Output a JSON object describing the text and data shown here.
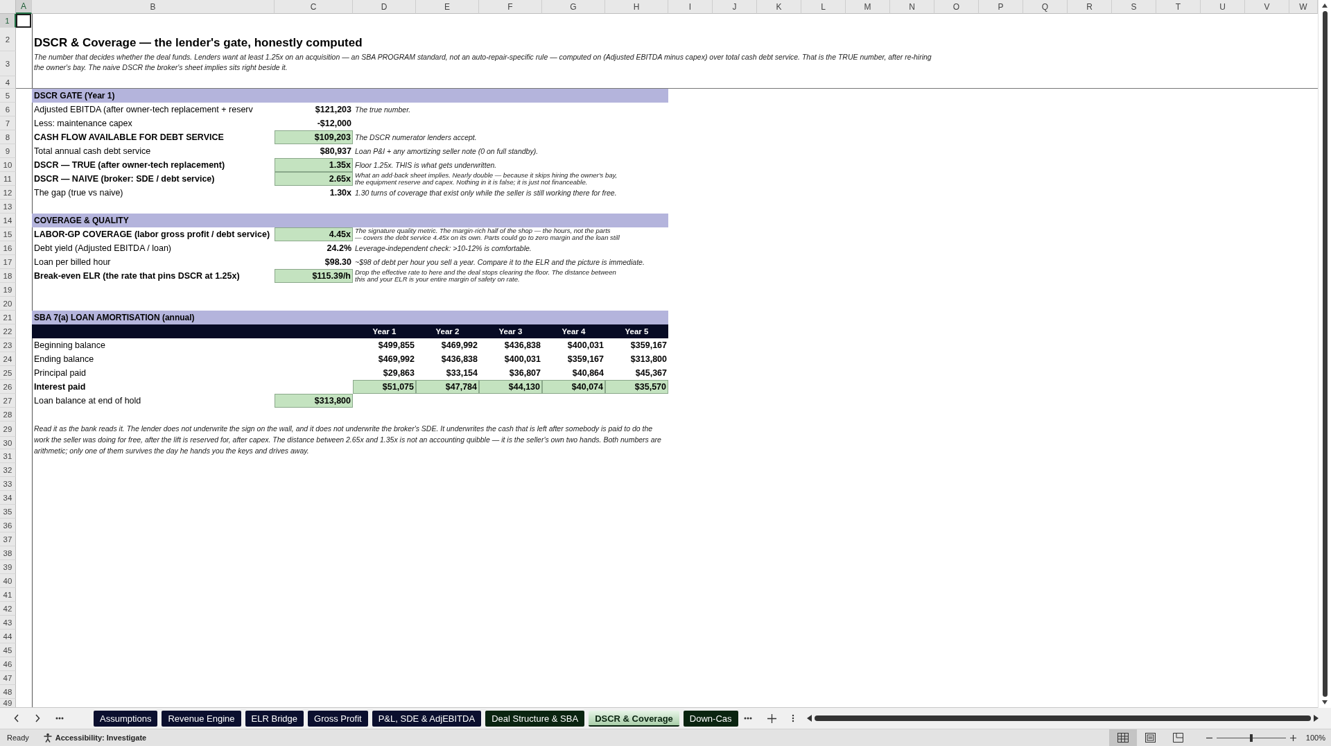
{
  "column_headers": [
    "A",
    "B",
    "C",
    "D",
    "E",
    "F",
    "G",
    "H",
    "I",
    "J",
    "K",
    "L",
    "M",
    "N",
    "O",
    "P",
    "Q",
    "R",
    "S",
    "T",
    "U",
    "V",
    "W"
  ],
  "row_numbers": [
    "1",
    "2",
    "3",
    "4",
    "5",
    "6",
    "7",
    "8",
    "9",
    "10",
    "11",
    "12",
    "13",
    "14",
    "15",
    "16",
    "17",
    "18",
    "19",
    "20",
    "21",
    "22",
    "23",
    "24",
    "25",
    "26",
    "27",
    "28",
    "29",
    "30",
    "31",
    "32",
    "33",
    "34",
    "35",
    "36",
    "37",
    "38",
    "39",
    "40",
    "41",
    "42",
    "43",
    "44",
    "45",
    "46",
    "47",
    "48",
    "49"
  ],
  "title": "DSCR & Coverage — the lender's gate, honestly computed",
  "intro": "The number that decides whether the deal funds. Lenders want at least 1.25x on an acquisition — an SBA PROGRAM standard, not an auto-repair-specific rule — computed on (Adjusted EBITDA minus capex) over total cash debt service. That is the TRUE number, after re-hiring the owner's bay. The naive DSCR the broker's sheet implies sits right beside it.",
  "sections": [
    {
      "heading": "DSCR GATE (Year 1)",
      "rows": [
        {
          "label": "Adjusted EBITDA (after owner-tech replacement + reserv",
          "bold": false,
          "value": "$121,203",
          "highlighted": false,
          "note": [
            "The true number."
          ]
        },
        {
          "label": "Less: maintenance capex",
          "bold": false,
          "value": "-$12,000",
          "highlighted": false,
          "note": []
        },
        {
          "label": "CASH FLOW AVAILABLE FOR DEBT SERVICE",
          "bold": true,
          "value": "$109,203",
          "highlighted": true,
          "note": [
            "The DSCR numerator lenders accept."
          ]
        },
        {
          "label": "Total annual cash debt service",
          "bold": false,
          "value": "$80,937",
          "highlighted": false,
          "note": [
            "Loan P&I + any amortizing seller note (0 on full standby)."
          ]
        },
        {
          "label": "DSCR — TRUE (after owner-tech replacement)",
          "bold": true,
          "value": "1.35x",
          "highlighted": true,
          "note": [
            "Floor 1.25x. THIS is what gets underwritten."
          ]
        },
        {
          "label": "DSCR — NAIVE (broker: SDE / debt service)",
          "bold": true,
          "value": "2.65x",
          "highlighted": true,
          "note": [
            "What an add-back sheet implies. Nearly double — because it skips hiring the owner's bay,",
            "the equipment reserve and capex. Nothing in it is false; it is just not financeable."
          ]
        },
        {
          "label": "The gap (true vs naive)",
          "bold": false,
          "value": "1.30x",
          "highlighted": false,
          "note": [
            "1.30 turns of coverage that exist only while the seller is still working there for free."
          ]
        }
      ]
    },
    {
      "heading": "COVERAGE & QUALITY",
      "rows": [
        {
          "label": "LABOR-GP COVERAGE (labor gross profit / debt service)",
          "bold": true,
          "value": "4.45x",
          "highlighted": true,
          "note": [
            "The signature quality metric. The margin-rich half of the shop — the hours, not the parts",
            "— covers the debt service 4.45x on its own. Parts could go to zero margin and the loan still"
          ]
        },
        {
          "label": "Debt yield (Adjusted EBITDA / loan)",
          "bold": false,
          "value": "24.2%",
          "highlighted": false,
          "note": [
            "Leverage-independent check: >10-12% is comfortable."
          ]
        },
        {
          "label": "Loan per billed hour",
          "bold": false,
          "value": "$98.30",
          "highlighted": false,
          "note": [
            "~$98 of debt per hour you sell a year. Compare it to the ELR and the picture is immediate."
          ]
        },
        {
          "label": "Break-even ELR (the rate that pins DSCR at 1.25x)",
          "bold": true,
          "value": "$115.39/h",
          "highlighted": true,
          "note": [
            "Drop the effective rate to here and the deal stops clearing the floor. The distance between",
            "this and your ELR is your entire margin of safety on rate."
          ]
        }
      ]
    }
  ],
  "amortisation": {
    "heading": "SBA 7(a) LOAN AMORTISATION (annual)",
    "columns": [
      "Year 1",
      "Year 2",
      "Year 3",
      "Year 4",
      "Year 5"
    ],
    "rows": [
      {
        "label": "Beginning balance",
        "bold": false,
        "highlighted": false,
        "values": [
          "$499,855",
          "$469,992",
          "$436,838",
          "$400,031",
          "$359,167"
        ]
      },
      {
        "label": "Ending balance",
        "bold": false,
        "highlighted": false,
        "values": [
          "$469,992",
          "$436,838",
          "$400,031",
          "$359,167",
          "$313,800"
        ]
      },
      {
        "label": "Principal paid",
        "bold": false,
        "highlighted": false,
        "values": [
          "$29,863",
          "$33,154",
          "$36,807",
          "$40,864",
          "$45,367"
        ]
      },
      {
        "label": "Interest paid",
        "bold": true,
        "highlighted": true,
        "values": [
          "$51,075",
          "$47,784",
          "$44,130",
          "$40,074",
          "$35,570"
        ]
      }
    ],
    "end_balance": {
      "label": "Loan balance at end of hold",
      "value": "$313,800",
      "highlighted": true
    }
  },
  "closing_note": "Read it as the bank reads it. The lender does not underwrite the sign on the wall, and it does not underwrite the broker's SDE. It underwrites the cash that is left after somebody is paid to do the work the seller was doing for free, after the lift is reserved for, after capex. The distance between 2.65x and 1.35x is not an accounting quibble — it is the seller's own two hands. Both numbers are arithmetic; only one of them survives the day he hands you the keys and drives away.",
  "sheet_tabs": [
    {
      "label": "Assumptions",
      "selected": false,
      "color": "#0b0f2e"
    },
    {
      "label": "Revenue Engine",
      "selected": false,
      "color": "#0b0f2e"
    },
    {
      "label": "ELR Bridge",
      "selected": false,
      "color": "#0b0f2e"
    },
    {
      "label": "Gross Profit",
      "selected": false,
      "color": "#0b0f2e"
    },
    {
      "label": "P&L, SDE & AdjEBITDA",
      "selected": false,
      "color": "#0b0f2e"
    },
    {
      "label": "Deal Structure & SBA",
      "selected": false,
      "color": "#0a2410"
    },
    {
      "label": "DSCR & Coverage",
      "selected": true,
      "color": "#0a2410"
    },
    {
      "label": "Down-Cas",
      "selected": false,
      "color": "#0a2410"
    }
  ],
  "status": {
    "mode": "Ready",
    "accessibility": "Accessibility: Investigate",
    "zoom": "100%",
    "zoom_slider": {
      "level": 0.5
    }
  }
}
